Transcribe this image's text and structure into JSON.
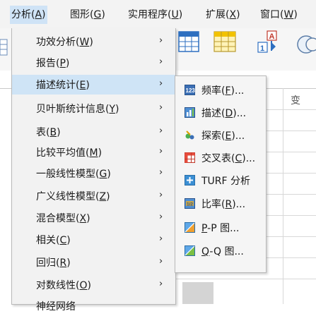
{
  "menubar": {
    "items": [
      {
        "label": "分析(",
        "mnemonic": "A",
        "suffix": ")"
      },
      {
        "label": "图形(",
        "mnemonic": "G",
        "suffix": ")"
      },
      {
        "label": "实用程序(",
        "mnemonic": "U",
        "suffix": ")"
      },
      {
        "label": "扩展(",
        "mnemonic": "X",
        "suffix": ")"
      },
      {
        "label": "窗口(",
        "mnemonic": "W",
        "suffix": ")"
      }
    ]
  },
  "grid": {
    "column_header_partial": "变"
  },
  "analyze_menu": {
    "items": [
      {
        "label": "功效分析(",
        "mnemonic": "W",
        "suffix": ")",
        "arrow": "›"
      },
      {
        "label": "报告(",
        "mnemonic": "P",
        "suffix": ")",
        "arrow": "›"
      },
      {
        "label": "描述统计(",
        "mnemonic": "E",
        "suffix": ")",
        "arrow": "›"
      },
      {
        "label": "贝叶斯统计信息(",
        "mnemonic": "Y",
        "suffix": ")",
        "arrow": "›"
      },
      {
        "label": "表(",
        "mnemonic": "B",
        "suffix": ")",
        "arrow": "›"
      },
      {
        "label": "比较平均值(",
        "mnemonic": "M",
        "suffix": ")",
        "arrow": "›"
      },
      {
        "label": "一般线性模型(",
        "mnemonic": "G",
        "suffix": ")",
        "arrow": "›"
      },
      {
        "label": "广义线性模型(",
        "mnemonic": "Z",
        "suffix": ")",
        "arrow": "›"
      },
      {
        "label": "混合模型(",
        "mnemonic": "X",
        "suffix": ")",
        "arrow": "›"
      },
      {
        "label": "相关(",
        "mnemonic": "C",
        "suffix": ")",
        "arrow": "›"
      },
      {
        "label": "回归(",
        "mnemonic": "R",
        "suffix": ")",
        "arrow": "›"
      },
      {
        "label": "对数线性(",
        "mnemonic": "O",
        "suffix": ")",
        "arrow": "›"
      },
      {
        "label": "神经网络",
        "mnemonic": "",
        "suffix": "",
        "arrow": ""
      }
    ]
  },
  "descriptive_submenu": {
    "items": [
      {
        "label": "频率(",
        "mnemonic": "F",
        "suffix": ")...",
        "icon": "frequencies-icon"
      },
      {
        "label": "描述(",
        "mnemonic": "D",
        "suffix": ")...",
        "icon": "descriptives-icon"
      },
      {
        "label": "探索(",
        "mnemonic": "E",
        "suffix": ")...",
        "icon": "explore-icon"
      },
      {
        "label": "交叉表(",
        "mnemonic": "C",
        "suffix": ")...",
        "icon": "crosstabs-icon"
      },
      {
        "label": "TURF 分析",
        "mnemonic": "",
        "suffix": "",
        "icon": "turf-icon"
      },
      {
        "label": "比率(",
        "mnemonic": "R",
        "suffix": ")...",
        "icon": "ratio-icon"
      },
      {
        "label": "",
        "mnemonic": "P",
        "suffix": "-P 图...",
        "icon": "pp-plot-icon"
      },
      {
        "label": "",
        "mnemonic": "Q",
        "suffix": "-Q 图...",
        "icon": "qq-plot-icon"
      }
    ]
  }
}
